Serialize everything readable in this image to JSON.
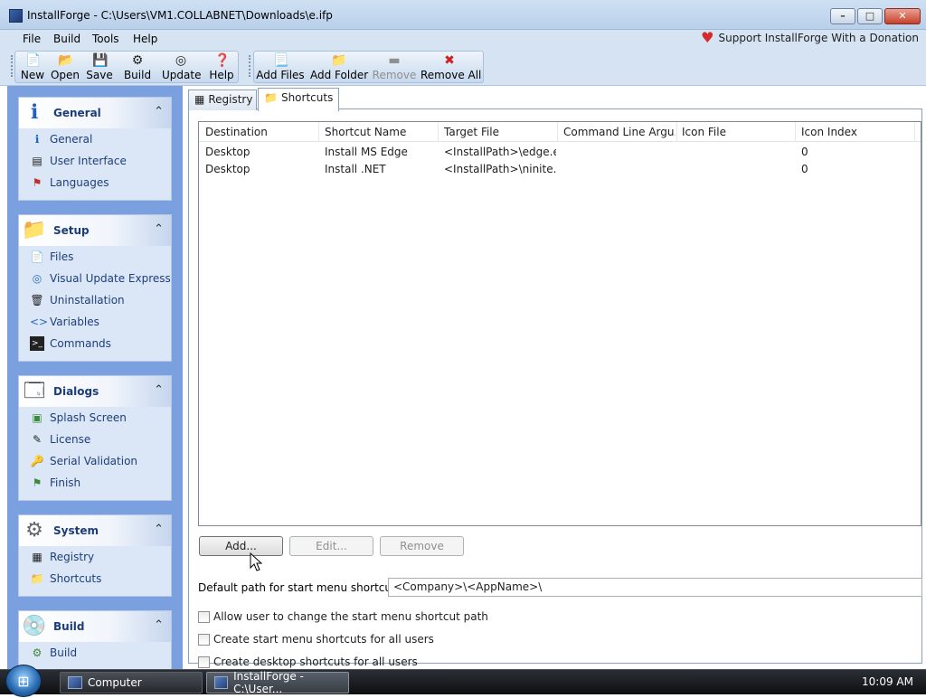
{
  "window": {
    "title": "InstallForge - C:\\Users\\VM1.COLLABNET\\Downloads\\e.ifp",
    "app_icon": "installforge-icon"
  },
  "menu": {
    "items": [
      "File",
      "Build",
      "Tools",
      "Help"
    ],
    "donate": "Support InstallForge With a Donation"
  },
  "toolbar": {
    "new": "New",
    "open": "Open",
    "save": "Save",
    "build": "Build",
    "update": "Update",
    "help": "Help",
    "add_files": "Add Files",
    "add_folder": "Add Folder",
    "remove": "Remove",
    "remove_all": "Remove All"
  },
  "sidebar": {
    "general": {
      "title": "General",
      "items": [
        "General",
        "User Interface",
        "Languages"
      ]
    },
    "setup": {
      "title": "Setup",
      "items": [
        "Files",
        "Visual Update Express",
        "Uninstallation",
        "Variables",
        "Commands"
      ]
    },
    "dialogs": {
      "title": "Dialogs",
      "items": [
        "Splash Screen",
        "License",
        "Serial Validation",
        "Finish"
      ]
    },
    "system": {
      "title": "System",
      "items": [
        "Registry",
        "Shortcuts"
      ]
    },
    "build": {
      "title": "Build",
      "items": [
        "Build"
      ]
    }
  },
  "tabs": [
    "Registry",
    "Shortcuts"
  ],
  "table": {
    "columns": [
      "Destination",
      "Shortcut Name",
      "Target File",
      "Command Line Argu...",
      "Icon File",
      "Icon Index"
    ],
    "rows": [
      [
        "Desktop",
        "Install MS Edge",
        "<InstallPath>\\edge.e...",
        "",
        "",
        "0"
      ],
      [
        "Desktop",
        "Install .NET",
        "<InstallPath>\\ninite....",
        "",
        "",
        "0"
      ]
    ]
  },
  "buttons": {
    "add": "Add...",
    "edit": "Edit...",
    "remove": "Remove"
  },
  "default_path": {
    "label": "Default path for start menu shortcuts:",
    "value": "<Company>\\<AppName>\\"
  },
  "options": [
    "Allow user to change the start menu shortcut path",
    "Create start menu shortcuts for all users",
    "Create desktop shortcuts for all users"
  ],
  "taskbar": {
    "items": [
      "Computer",
      "InstallForge - C:\\User..."
    ],
    "clock": "10:09 AM"
  }
}
